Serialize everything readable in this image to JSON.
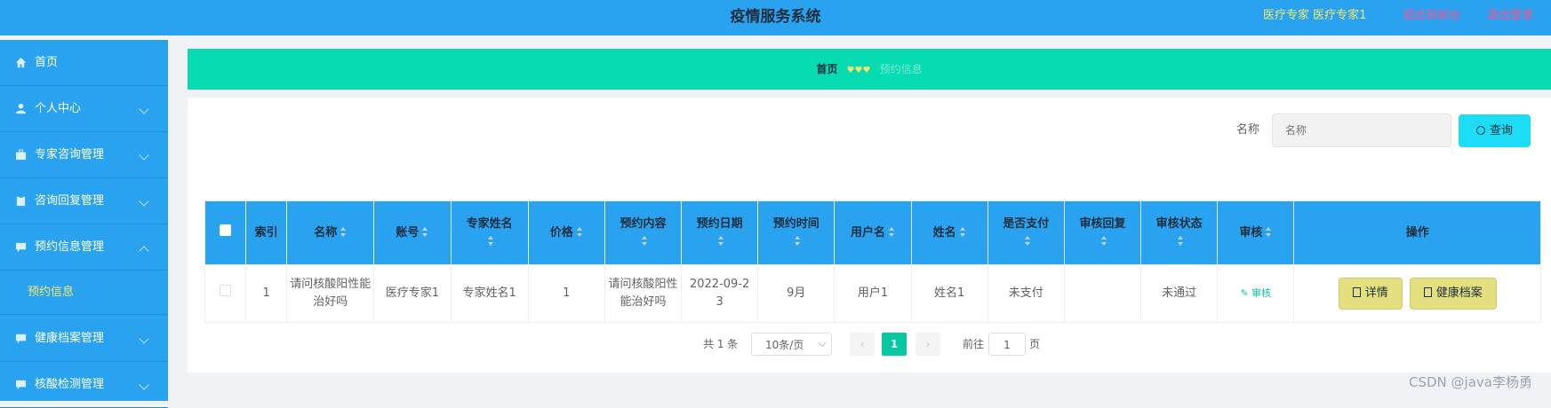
{
  "header": {
    "title": "疫情服务系统",
    "user_label": "医疗专家 医疗专家1",
    "exit_to_frontend": "退出到前台",
    "logout": "退出登录"
  },
  "sidebar": {
    "items": [
      {
        "label": "首页",
        "icon": "home-icon"
      },
      {
        "label": "个人中心",
        "icon": "user-icon"
      },
      {
        "label": "专家咨询管理",
        "icon": "briefcase-icon"
      },
      {
        "label": "咨询回复管理",
        "icon": "clipboard-icon"
      },
      {
        "label": "预约信息管理",
        "icon": "chat-icon",
        "expanded": true
      },
      {
        "label": "健康档案管理",
        "icon": "chat-icon"
      },
      {
        "label": "核酸检测管理",
        "icon": "chat-icon"
      }
    ],
    "active_subitem": "预约信息"
  },
  "breadcrumb": {
    "home": "首页",
    "current": "预约信息"
  },
  "search": {
    "label": "名称",
    "placeholder": "名称",
    "button": "查询"
  },
  "table": {
    "columns": [
      "索引",
      "名称",
      "账号",
      "专家姓名",
      "价格",
      "预约内容",
      "预约日期",
      "预约时间",
      "用户名",
      "姓名",
      "是否支付",
      "审核回复",
      "审核状态",
      "审核",
      "操作"
    ],
    "rows": [
      {
        "index": "1",
        "name": "请问核酸阳性能治好吗",
        "account": "医疗专家1",
        "expert_name": "专家姓名1",
        "price": "1",
        "content": "请问核酸阳性能治好吗",
        "date": "2022-09-23",
        "time": "9月",
        "username": "用户1",
        "real_name": "姓名1",
        "paid": "未支付",
        "reply": "",
        "status": "未通过",
        "review": "审核",
        "detail_button": "详情",
        "health_button": "健康档案"
      }
    ]
  },
  "pagination": {
    "total": "共 1 条",
    "page_size": "10条/页",
    "current_page": "1",
    "goto_prefix": "前往",
    "goto_value": "1",
    "goto_suffix": "页"
  },
  "watermark": "CSDN @java李杨勇",
  "colors": {
    "primary": "#29a3f0",
    "accent": "#06dbb2",
    "search_button": "#1cdcf6",
    "action_button": "#e5e07f"
  }
}
